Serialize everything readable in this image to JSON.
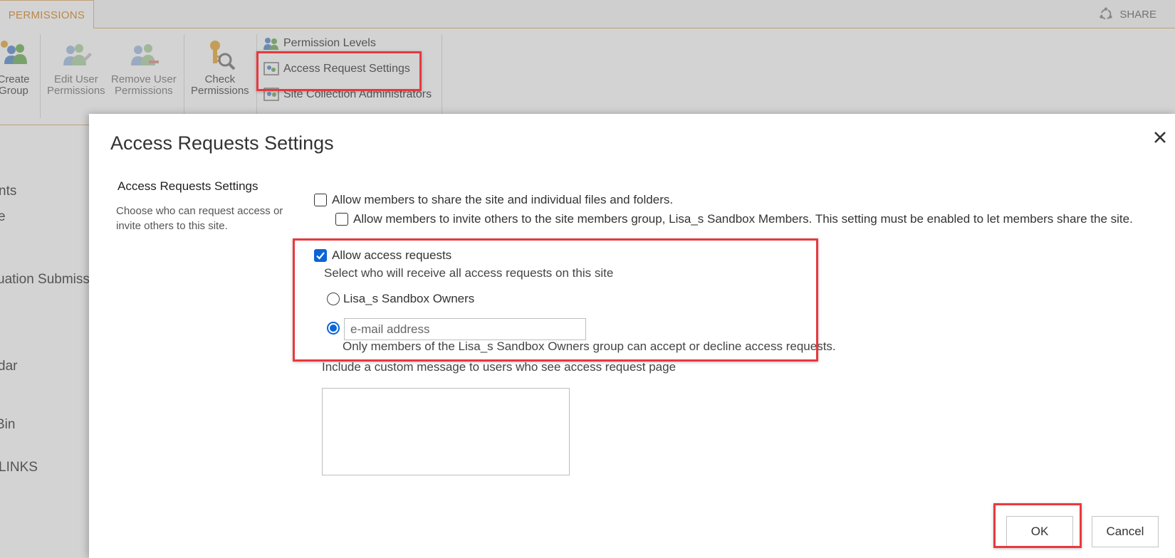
{
  "ribbon": {
    "tab_label": "PERMISSIONS",
    "share_label": "SHARE",
    "buttons": [
      {
        "line1": "Create",
        "line2": "Group"
      },
      {
        "line1": "Edit User",
        "line2": "Permissions"
      },
      {
        "line1": "Remove User",
        "line2": "Permissions"
      },
      {
        "line1": "Check",
        "line2": "Permissions"
      }
    ],
    "small_items": [
      "Permission Levels",
      "Access Request Settings",
      "Site Collection Administrators"
    ]
  },
  "left_nav": [
    "nts",
    "e",
    "uation Submissi",
    "dar",
    "Bin",
    "LINKS"
  ],
  "dialog": {
    "title": "Access Requests Settings",
    "section_title": "Access Requests Settings",
    "section_desc": "Choose who can request access or invite others to this site.",
    "opt_share": "Allow members to share the site and individual files and folders.",
    "opt_invite": "Allow members to invite others to the site members group, Lisa_s Sandbox Members. This setting must be enabled to let members share the site.",
    "opt_access": "Allow access requests",
    "select_who": "Select who will receive all access requests on this site",
    "radio_owners": "Lisa_s Sandbox Owners",
    "email_placeholder": "e-mail address",
    "owners_note": "Only members of the Lisa_s Sandbox Owners group can accept or decline access requests.",
    "custom_msg_label": "Include a custom message to users who see access request page",
    "custom_msg_value": "",
    "ok_label": "OK",
    "cancel_label": "Cancel"
  },
  "state": {
    "allow_share": false,
    "allow_invite": false,
    "allow_access_requests": true,
    "recipient": "email"
  },
  "colors": {
    "accent": "#d9851f",
    "highlight": "#e8393d",
    "checked": "#0b65d8"
  }
}
